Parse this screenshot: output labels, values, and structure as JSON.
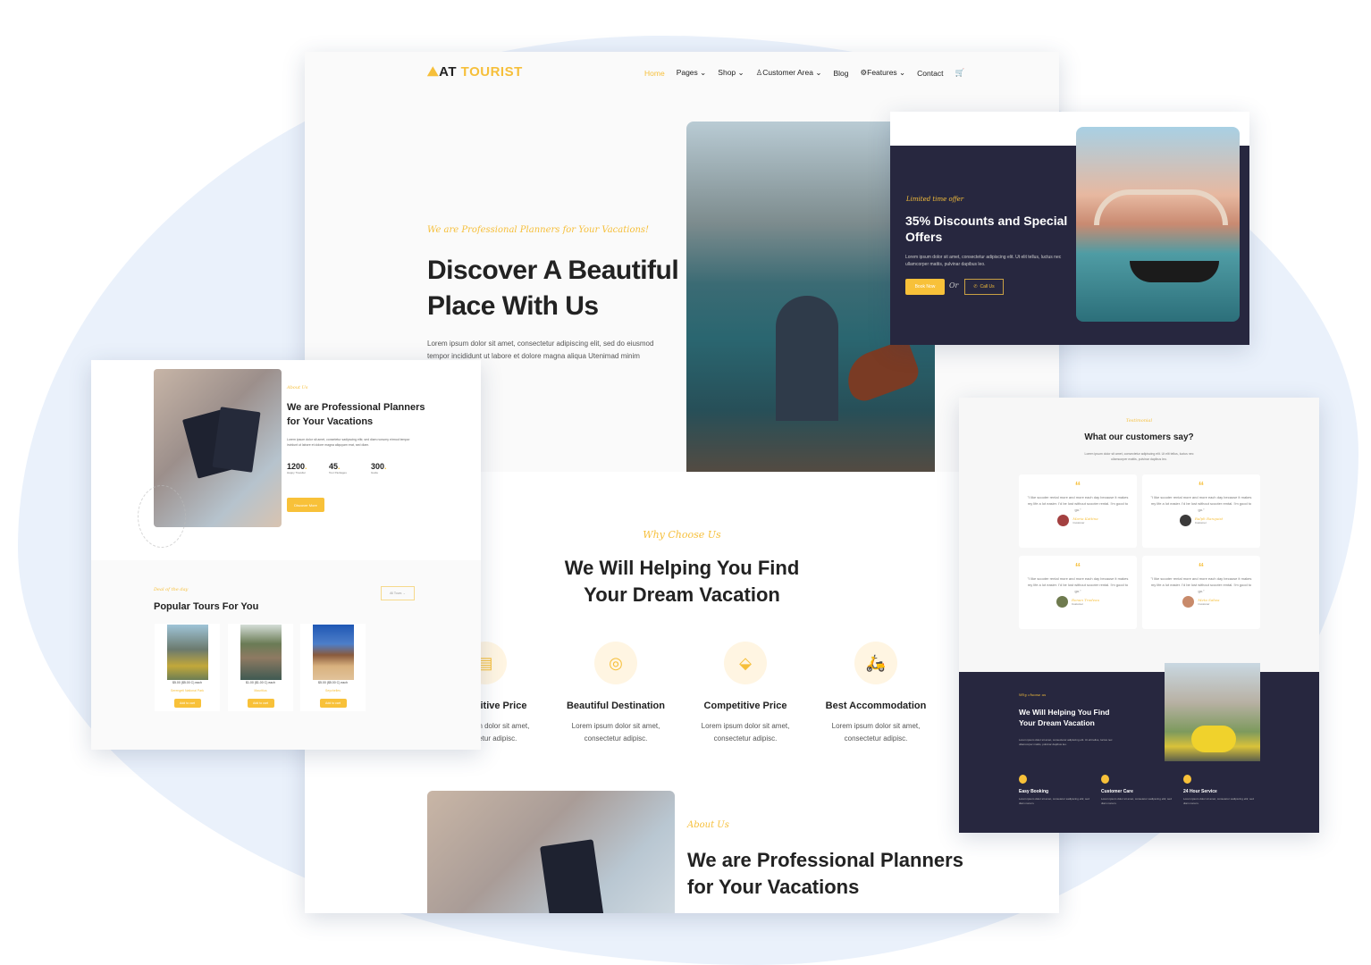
{
  "colors": {
    "accent": "#f8c139",
    "dark": "#27273f",
    "background_blob": "#eaf1fb"
  },
  "main": {
    "logo": {
      "prefix": "AT",
      "name": "TOURIST",
      "icon": "tourist-hiker-icon"
    },
    "nav": [
      {
        "label": "Home",
        "active": true
      },
      {
        "label": "Pages",
        "dropdown": true
      },
      {
        "label": "Shop",
        "dropdown": true
      },
      {
        "label": "Customer Area",
        "dropdown": true,
        "icon": "user-icon"
      },
      {
        "label": "Blog"
      },
      {
        "label": "Features",
        "dropdown": true,
        "icon": "gear-icon"
      },
      {
        "label": "Contact"
      },
      {
        "label": "",
        "icon": "cart-icon"
      }
    ],
    "hero": {
      "tagline": "We are Professional Planners for Your Vacations!",
      "title_line1": "Discover A Beautiful",
      "title_line2": "Place With Us",
      "text": "Lorem ipsum dolor sit amet, consectetur adipiscing elit, sed do eiusmod tempor incididunt ut labore et dolore magna aliqua Utenimad minim veniam."
    },
    "why": {
      "tagline": "Why Choose Us",
      "title_line1": "We Will Helping You Find",
      "title_line2": "Your Dream Vacation",
      "features": [
        {
          "title": "Competitive Price",
          "text": "Lorem ipsum dolor sit amet, consectetur adipisc.",
          "icon": "clipboard-icon"
        },
        {
          "title": "Beautiful Destination",
          "text": "Lorem ipsum dolor sit amet, consectetur adipisc.",
          "icon": "map-pin-icon"
        },
        {
          "title": "Competitive Price",
          "text": "Lorem ipsum dolor sit amet, consectetur adipisc.",
          "icon": "price-tag-icon"
        },
        {
          "title": "Best Accommodation",
          "text": "Lorem ipsum dolor sit amet, consectetur adipisc.",
          "icon": "scooter-icon"
        }
      ]
    },
    "about": {
      "tagline": "About Us",
      "title_line1": "We are Professional Planners",
      "title_line2": "for Your Vacations"
    }
  },
  "offer": {
    "tagline": "Limited time offer",
    "title_line1": "35% Discounts and Special",
    "title_line2": "Offers",
    "text": "Lorem ipsum dolor sit amet, consectetur adipiscing elit. Ut elit tellus, luctus nec ullamcorper mattis, pulvinar dapibus leo.",
    "book_label": "Book Now",
    "or_label": "Or",
    "call_label": "Call Us"
  },
  "about_panel": {
    "tagline": "About Us",
    "title_line1": "We are Professional Planners",
    "title_line2": "for Your Vacations",
    "text": "Lorem ipsum dolor sit amet, consetetur sadipscing elitr, sed diam nonumy eirmod tempor invidunt ut labore et dolore magna aliquyam erat, sed diam.",
    "stats": [
      {
        "value": "1200",
        "label": "Happy Traveller"
      },
      {
        "value": "45",
        "label": "Tour Packages"
      },
      {
        "value": "300",
        "label": "Guide"
      }
    ],
    "button": "Discover More",
    "deal_tagline": "Deal of the day",
    "deal_title": "Popular Tours For You",
    "all_tours": "All Tours →",
    "tours": [
      {
        "price": "$5.00 ($5.00 C) each",
        "name": "Serengeti National Park",
        "button": "Add to cart"
      },
      {
        "price": "$1.00 ($1.00 C) each",
        "name": "Mauritius",
        "button": "Add to cart"
      },
      {
        "price": "$5.00 ($5.00 C) each",
        "name": "Seychelles",
        "button": "Add to cart"
      }
    ]
  },
  "testimonials": {
    "tagline": "Testimonial",
    "title": "What our customers say?",
    "text": "Lorem ipsum dolor sit amet, consectetur adipiscing elit. Ut elit tellus, luctus nec ullamcorper mattis, pulvinar dapibus leo.",
    "items": [
      {
        "quote": "\"I like scooter rental more and more each day because it makes my life a lot easier. I'd be lost without scooter rental. I'm good to go.\"",
        "name": "Maria Kattina",
        "role": "Customer"
      },
      {
        "quote": "\"I like scooter rental more and more each day because it makes my life a lot easier. I'd be lost without scooter rental. I'm good to go.\"",
        "name": "Ralph Ranquist",
        "role": "Customer"
      },
      {
        "quote": "\"I like scooter rental more and more each day because it makes my life a lot easier. I'd be lost without scooter rental. I'm good to go.\"",
        "name": "Ronan Trodeau",
        "role": "Customer"
      },
      {
        "quote": "\"I like scooter rental more and more each day because it makes my life a lot easier. I'd be lost without scooter rental. I'm good to go.\"",
        "name": "Meta Sabea",
        "role": "Customer"
      }
    ],
    "why": {
      "tagline": "Why choose us",
      "title_line1": "We Will Helping You Find",
      "title_line2": "Your Dream Vacation",
      "text": "Lorem ipsum dolor sit amet, consectetur adipiscing elit. Ut elit tellus, luctus nec ullamcorper mattis, pulvinar dapibus leo.",
      "services": [
        {
          "title": "Easy Booking",
          "text": "Lorem ipsum dolor sit amet, consetetur sadipscing elitr, sed diam nonum."
        },
        {
          "title": "Customer Care",
          "text": "Lorem ipsum dolor sit amet, consetetur sadipscing elitr, sed diam nonum."
        },
        {
          "title": "24 Hour Service",
          "text": "Lorem ipsum dolor sit amet, consetetur sadipscing elitr, sed diam nonum."
        }
      ]
    }
  }
}
